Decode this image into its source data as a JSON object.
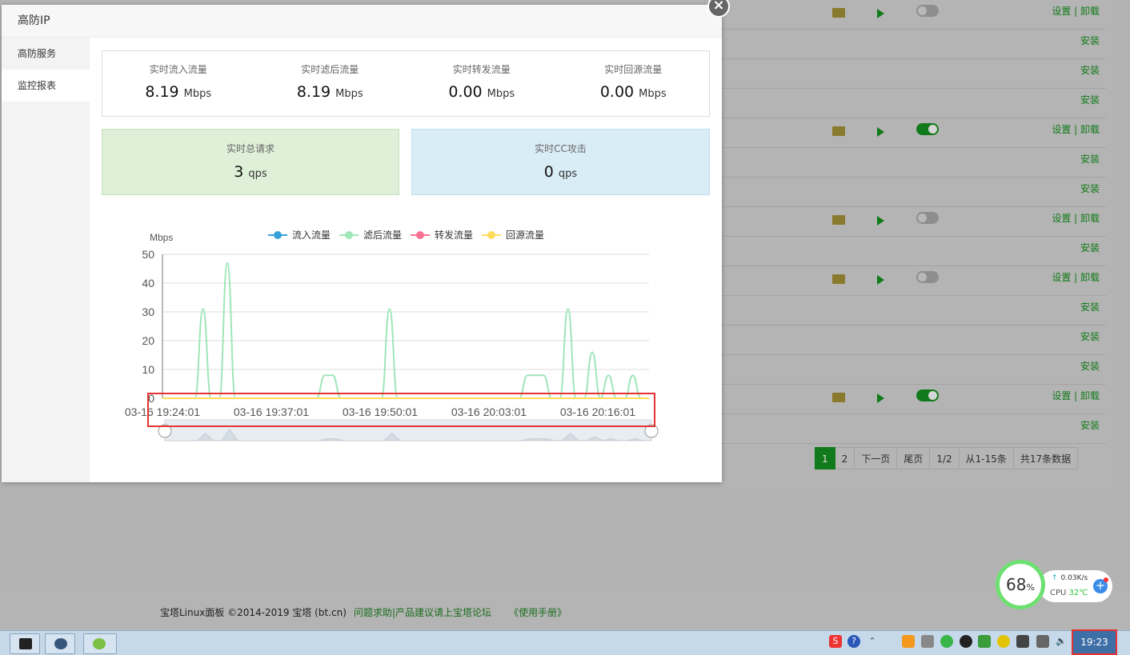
{
  "modal": {
    "title": "高防IP",
    "close_label": "×",
    "menu": [
      {
        "label": "高防服务",
        "active": false
      },
      {
        "label": "监控报表",
        "active": true
      }
    ],
    "traffic": [
      {
        "label": "实时流入流量",
        "value": "8.19",
        "unit": "Mbps"
      },
      {
        "label": "实时滤后流量",
        "value": "8.19",
        "unit": "Mbps"
      },
      {
        "label": "实时转发流量",
        "value": "0.00",
        "unit": "Mbps"
      },
      {
        "label": "实时回源流量",
        "value": "0.00",
        "unit": "Mbps"
      }
    ],
    "requests": {
      "label": "实时总请求",
      "value": "3",
      "unit": "qps"
    },
    "cc_attack": {
      "label": "实时CC攻击",
      "value": "0",
      "unit": "qps"
    }
  },
  "chart_data": {
    "type": "line",
    "ylabel": "Mbps",
    "ylim": [
      0,
      50
    ],
    "yticks": [
      0,
      10,
      20,
      30,
      40,
      50
    ],
    "xtick_labels": [
      "03-16 19:24:01",
      "03-16 19:37:01",
      "03-16 19:50:01",
      "03-16 20:03:01",
      "03-16 20:16:01"
    ],
    "legend_position": "top",
    "series": [
      {
        "name": "流入流量",
        "color": "#37a2da",
        "values": [
          0,
          0,
          0,
          0,
          0,
          0,
          0,
          0,
          0,
          0,
          0,
          0,
          0,
          0,
          0,
          0,
          0,
          0,
          0,
          0,
          0,
          0,
          0,
          0,
          0,
          0,
          0,
          0,
          0,
          0,
          0,
          0,
          0,
          0,
          0,
          0,
          0,
          0,
          0,
          0,
          0,
          0,
          0,
          0,
          0,
          0,
          0,
          0,
          0,
          0,
          0,
          0,
          0,
          0,
          0,
          0,
          0,
          0,
          0,
          0,
          0
        ]
      },
      {
        "name": "滤后流量",
        "color": "#9fe6b8",
        "values": [
          0,
          0,
          0,
          0,
          0,
          31,
          0,
          0,
          47,
          0,
          0,
          0,
          0,
          0,
          0,
          0,
          0,
          0,
          0,
          0,
          8,
          8,
          0,
          0,
          0,
          0,
          0,
          0,
          31,
          0,
          0,
          0,
          0,
          0,
          0,
          0,
          0,
          0,
          0,
          0,
          0,
          0,
          0,
          0,
          0,
          8,
          8,
          8,
          0,
          0,
          31,
          0,
          0,
          16,
          0,
          8,
          0,
          0,
          8,
          0,
          0
        ]
      },
      {
        "name": "转发流量",
        "color": "#fb7293",
        "values": [
          0,
          0,
          0,
          0,
          0,
          0,
          0,
          0,
          0,
          0,
          0,
          0,
          0,
          0,
          0,
          0,
          0,
          0,
          0,
          0,
          0,
          0,
          0,
          0,
          0,
          0,
          0,
          0,
          0,
          0,
          0,
          0,
          0,
          0,
          0,
          0,
          0,
          0,
          0,
          0,
          0,
          0,
          0,
          0,
          0,
          0,
          0,
          0,
          0,
          0,
          0,
          0,
          0,
          0,
          0,
          0,
          0,
          0,
          0,
          0,
          0
        ]
      },
      {
        "name": "回源流量",
        "color": "#ffdb5c",
        "values": [
          0,
          0,
          0,
          0,
          0,
          0,
          0,
          0,
          0,
          0,
          0,
          0,
          0,
          0,
          0,
          0,
          0,
          0,
          0,
          0,
          0,
          0,
          0,
          0,
          0,
          0,
          0,
          0,
          0,
          0,
          0,
          0,
          0,
          0,
          0,
          0,
          0,
          0,
          0,
          0,
          0,
          0,
          0,
          0,
          0,
          0,
          0,
          0,
          0,
          0,
          0,
          0,
          0,
          0,
          0,
          0,
          0,
          0,
          0,
          0,
          0
        ]
      }
    ]
  },
  "background_list": {
    "rows": [
      {
        "has_controls": true,
        "toggle_on": false,
        "actions": "设置 | 卸载"
      },
      {
        "has_controls": false,
        "actions": "安装"
      },
      {
        "has_controls": false,
        "actions": "安装"
      },
      {
        "has_controls": false,
        "actions": "安装"
      },
      {
        "has_controls": true,
        "toggle_on": true,
        "actions": "设置 | 卸载"
      },
      {
        "has_controls": false,
        "actions": "安装"
      },
      {
        "has_controls": false,
        "actions": "安装"
      },
      {
        "has_controls": true,
        "toggle_on": false,
        "actions": "设置 | 卸载"
      },
      {
        "has_controls": false,
        "actions": "安装"
      },
      {
        "has_controls": true,
        "toggle_on": false,
        "actions": "设置 | 卸载"
      },
      {
        "has_controls": false,
        "actions": "安装"
      },
      {
        "has_controls": false,
        "actions": "安装"
      },
      {
        "has_controls": false,
        "actions": "安装"
      },
      {
        "has_controls": true,
        "toggle_on": true,
        "actions": "设置 | 卸载"
      },
      {
        "has_controls": false,
        "actions": "安装"
      }
    ]
  },
  "pagination": {
    "items": [
      {
        "label": "1",
        "active": true
      },
      {
        "label": "2",
        "active": false
      },
      {
        "label": "下一页",
        "active": false
      },
      {
        "label": "尾页",
        "active": false
      },
      {
        "label": "1/2",
        "active": false
      },
      {
        "label": "从1-15条",
        "active": false
      },
      {
        "label": "共17条数据",
        "active": false
      }
    ]
  },
  "footer": {
    "copyright": "宝塔Linux面板 ©2014-2019 宝塔 (bt.cn)",
    "forum_link": "问题求助|产品建议请上宝塔论坛",
    "manual_link": "《使用手册》"
  },
  "widget": {
    "cpu_percent": "68",
    "percent_sign": "%",
    "net_speed": "0.03K/s",
    "cpu_label": "CPU",
    "cpu_temp": "32℃"
  },
  "taskbar": {
    "clock": "19:23",
    "accent": "#3d6fa6"
  },
  "colors": {
    "brand_green": "#20a53a",
    "highlight_red": "#e53333"
  }
}
